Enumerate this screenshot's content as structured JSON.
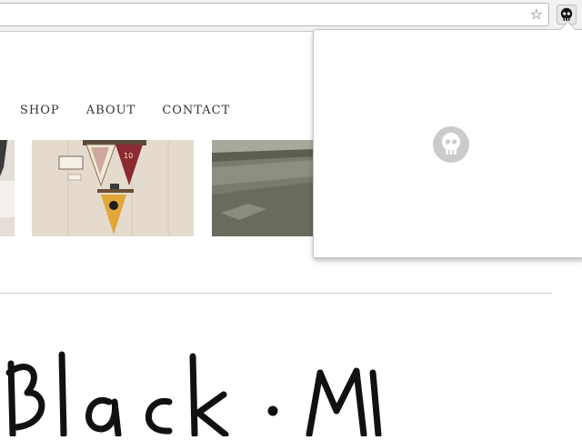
{
  "browser": {
    "address_value": "",
    "bookmark_icon": "star-icon",
    "extension_icon": "skull-icon"
  },
  "nav": {
    "items": [
      {
        "label": "SHOP"
      },
      {
        "label": "ABOUT"
      },
      {
        "label": "CONTACT"
      }
    ]
  },
  "gallery": {
    "items": [
      {
        "name": "partial-photo"
      },
      {
        "name": "pennants-photo",
        "pennant_number": "10"
      },
      {
        "name": "lake-photo"
      }
    ]
  },
  "heading_image": {
    "alt": "Black M"
  },
  "popup": {
    "logo_icon": "skull-icon"
  },
  "colors": {
    "pennant_red": "#8c2a32",
    "pennant_yellow": "#e0a837",
    "pennant_cream": "#f1ead8",
    "skull_gray": "#c8c8c8"
  }
}
